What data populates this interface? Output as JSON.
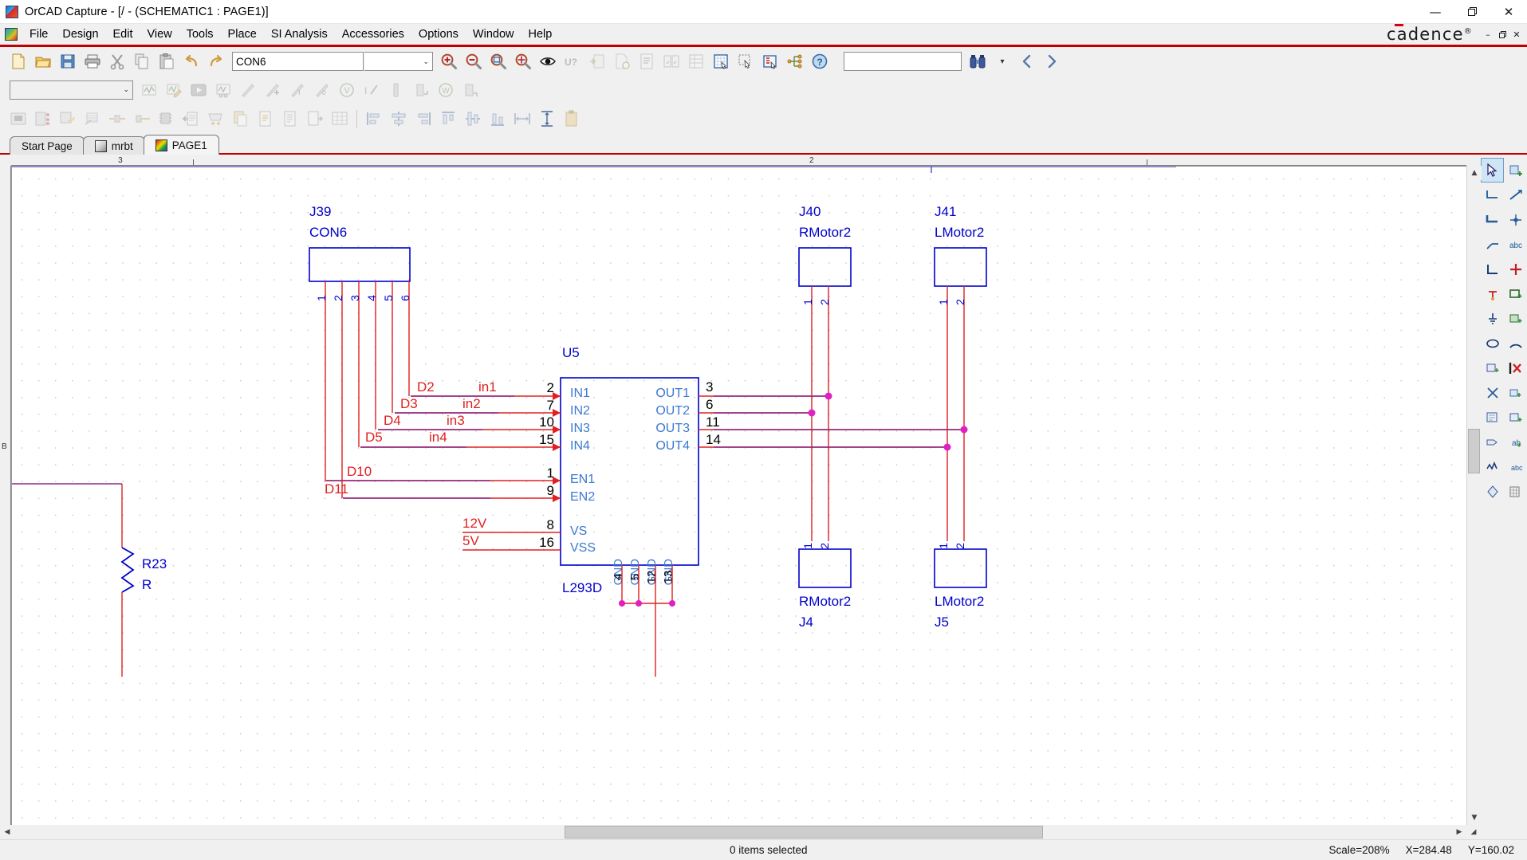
{
  "window": {
    "title": "OrCAD Capture - [/ - (SCHEMATIC1 : PAGE1)]",
    "minimize": "—",
    "maximize": "❐",
    "close": "✕",
    "mdi_minimize": "–",
    "mdi_restore": "❐",
    "mdi_close": "✕",
    "brand": "cadence",
    "brand_sup": "®"
  },
  "menu": {
    "items": [
      {
        "label": "File"
      },
      {
        "label": "Design"
      },
      {
        "label": "Edit"
      },
      {
        "label": "View"
      },
      {
        "label": "Tools"
      },
      {
        "label": "Place"
      },
      {
        "label": "SI Analysis"
      },
      {
        "label": "Accessories"
      },
      {
        "label": "Options"
      },
      {
        "label": "Window"
      },
      {
        "label": "Help"
      }
    ]
  },
  "toolbar1": {
    "part_combo_value": "CON6",
    "part_combo_caret": "⌄",
    "find_combo_value": "",
    "find_caret": "▾",
    "buttons": [
      {
        "name": "new-button",
        "title": "New"
      },
      {
        "name": "open-button",
        "title": "Open"
      },
      {
        "name": "save-button",
        "title": "Save"
      },
      {
        "name": "print-button",
        "title": "Print"
      },
      {
        "name": "cut-button",
        "title": "Cut"
      },
      {
        "name": "copy-button",
        "title": "Copy"
      },
      {
        "name": "paste-button",
        "title": "Paste"
      },
      {
        "name": "undo-button",
        "title": "Undo"
      },
      {
        "name": "redo-button",
        "title": "Redo"
      }
    ],
    "zoom_buttons": [
      {
        "name": "zoom-in-button",
        "title": "Zoom In"
      },
      {
        "name": "zoom-out-button",
        "title": "Zoom Out"
      },
      {
        "name": "zoom-area-button",
        "title": "Zoom Area"
      },
      {
        "name": "zoom-all-button",
        "title": "Zoom All"
      },
      {
        "name": "visibility-button",
        "title": "Visibility"
      }
    ],
    "doc_buttons": [
      {
        "name": "annotate-button",
        "title": "Annotate"
      },
      {
        "name": "backannotate-button",
        "title": "Back Annotate"
      },
      {
        "name": "design-rules-check-button",
        "title": "Design Rules Check"
      },
      {
        "name": "create-netlist-button",
        "title": "Create Netlist"
      },
      {
        "name": "cross-reference-button",
        "title": "Cross Reference Parts"
      },
      {
        "name": "bill-of-materials-button",
        "title": "Bill of Materials"
      },
      {
        "name": "snap-to-grid-button",
        "title": "Snap to Grid"
      },
      {
        "name": "area-select-button",
        "title": "Area Select"
      },
      {
        "name": "project-manager-button",
        "title": "Project Manager"
      },
      {
        "name": "hierarchy-button",
        "title": "Hierarchy"
      },
      {
        "name": "help-button",
        "title": "Help"
      }
    ],
    "nav_buttons": [
      {
        "name": "find-button",
        "title": "Find"
      },
      {
        "name": "find-dropdown-button",
        "title": "Find options"
      },
      {
        "name": "prev-button",
        "title": "Previous"
      },
      {
        "name": "next-button",
        "title": "Next"
      }
    ]
  },
  "toolbar2": {
    "combo_value": "",
    "combo_caret": "⌄",
    "buttons": [
      {
        "name": "pspice-new-simulation-button"
      },
      {
        "name": "pspice-edit-simulation-button"
      },
      {
        "name": "pspice-run-button"
      },
      {
        "name": "pspice-view-results-button"
      },
      {
        "name": "voltage-marker-button"
      },
      {
        "name": "current-marker-button"
      },
      {
        "name": "power-marker-button"
      },
      {
        "name": "db-magnitude-marker-button"
      },
      {
        "name": "voltage-level-marker-button"
      },
      {
        "name": "voltage-differential-marker-button"
      },
      {
        "name": "current-into-pin-marker-button"
      },
      {
        "name": "power-dissipation-marker-button"
      },
      {
        "name": "watt-marker-button"
      },
      {
        "name": "advanced-marker-button"
      }
    ]
  },
  "toolbar3": {
    "buttons": [
      {
        "name": "pcb-editor-button"
      },
      {
        "name": "pcb-footprint-button"
      },
      {
        "name": "pcb-constraint-button"
      },
      {
        "name": "pcb-layer-button"
      },
      {
        "name": "pcb-route-in-button"
      },
      {
        "name": "pcb-route-out-button"
      },
      {
        "name": "pcb-package-button"
      },
      {
        "name": "import-button"
      },
      {
        "name": "export-button"
      },
      {
        "name": "copy-design-button"
      },
      {
        "name": "edit-properties-button"
      },
      {
        "name": "view-report-button"
      },
      {
        "name": "export-report-button"
      },
      {
        "name": "spreadsheet-button"
      },
      {
        "name": "align-left-button"
      },
      {
        "name": "align-center-button"
      },
      {
        "name": "align-right-button"
      },
      {
        "name": "align-top-button"
      },
      {
        "name": "align-middle-button"
      },
      {
        "name": "align-bottom-button"
      },
      {
        "name": "distribute-horizontally-button"
      },
      {
        "name": "distribute-vertically-button"
      },
      {
        "name": "clipboard-button"
      }
    ]
  },
  "tabs": [
    {
      "label": "Start Page",
      "icon": "none",
      "active": false
    },
    {
      "label": "mrbt",
      "icon": "mrbt",
      "active": false
    },
    {
      "label": "PAGE1",
      "icon": "page",
      "active": true
    }
  ],
  "rulers": {
    "h_labels": [
      {
        "text": "3",
        "pos_pct": 7.5
      },
      {
        "text": "2",
        "pos_pct": 55.0
      }
    ],
    "v_labels": [
      {
        "text": "B",
        "pos_pct": 42.0
      }
    ]
  },
  "statusbar": {
    "selection": "0 items selected",
    "scale": "Scale=208%",
    "coord_x": "X=284.48",
    "coord_y": "Y=160.02"
  },
  "right_toolbar": {
    "buttons": [
      {
        "name": "select-tool-button",
        "selected": true
      },
      {
        "name": "place-part-button",
        "selected": false
      },
      {
        "name": "place-wire-button",
        "selected": false
      },
      {
        "name": "place-net-alias-button",
        "selected": false
      },
      {
        "name": "place-bus-button",
        "selected": false
      },
      {
        "name": "place-junction-button",
        "selected": false
      },
      {
        "name": "place-bus-entry-button",
        "selected": false
      },
      {
        "name": "place-text-button",
        "selected": false
      },
      {
        "name": "place-line-button",
        "selected": false
      },
      {
        "name": "place-cross-button",
        "selected": false
      },
      {
        "name": "place-power-button",
        "selected": false
      },
      {
        "name": "place-rectangle-button",
        "selected": false
      },
      {
        "name": "place-ground-button",
        "selected": false
      },
      {
        "name": "place-polyline-button",
        "selected": false
      },
      {
        "name": "place-ellipse-button",
        "selected": false
      },
      {
        "name": "place-arc-button",
        "selected": false
      },
      {
        "name": "place-port-button",
        "selected": false
      },
      {
        "name": "delete-button",
        "selected": false
      },
      {
        "name": "place-no-connect-button",
        "selected": false
      },
      {
        "name": "place-pin-button",
        "selected": false
      },
      {
        "name": "place-hierarchical-block-button",
        "selected": false
      },
      {
        "name": "place-hierarchical-pin-button",
        "selected": false
      },
      {
        "name": "place-off-page-connector-button",
        "selected": false
      },
      {
        "name": "place-alias-button",
        "selected": false
      },
      {
        "name": "zoom-selection-button",
        "selected": false
      },
      {
        "name": "place-picture-button",
        "selected": false
      },
      {
        "name": "place-elec-rule-button",
        "selected": false
      },
      {
        "name": "place-grid-button",
        "selected": false
      }
    ]
  },
  "schematic": {
    "components": [
      {
        "ref": "J39",
        "value": "CON6",
        "type": "connector",
        "pin_numbers": [
          "1",
          "2",
          "3",
          "4",
          "5",
          "6"
        ]
      },
      {
        "ref": "J40",
        "value": "RMotor2",
        "type": "connector",
        "pin_numbers": [
          "1",
          "2"
        ]
      },
      {
        "ref": "J41",
        "value": "LMotor2",
        "type": "connector",
        "pin_numbers": [
          "1",
          "2"
        ]
      },
      {
        "ref": "J4",
        "value": "RMotor2",
        "type": "connector",
        "pin_numbers": [
          "1",
          "2"
        ]
      },
      {
        "ref": "J5",
        "value": "LMotor2",
        "type": "connector",
        "pin_numbers": [
          "1",
          "2"
        ]
      },
      {
        "ref": "U5",
        "value": "L293D",
        "type": "ic",
        "left_pins": [
          {
            "num": "2",
            "name": "IN1"
          },
          {
            "num": "7",
            "name": "IN2"
          },
          {
            "num": "10",
            "name": "IN3"
          },
          {
            "num": "15",
            "name": "IN4"
          },
          {
            "num": "1",
            "name": "EN1"
          },
          {
            "num": "9",
            "name": "EN2"
          },
          {
            "num": "8",
            "name": "VS"
          },
          {
            "num": "16",
            "name": "VSS"
          }
        ],
        "right_pins": [
          {
            "num": "3",
            "name": "OUT1"
          },
          {
            "num": "6",
            "name": "OUT2"
          },
          {
            "num": "11",
            "name": "OUT3"
          },
          {
            "num": "14",
            "name": "OUT4"
          }
        ],
        "bottom_pins": [
          {
            "num": "4",
            "name": "GND"
          },
          {
            "num": "5",
            "name": "GND"
          },
          {
            "num": "12",
            "name": "GND"
          },
          {
            "num": "13",
            "name": "GND"
          }
        ]
      },
      {
        "ref": "R23",
        "value": "R",
        "type": "resistor"
      }
    ],
    "net_labels": [
      {
        "text": "D2"
      },
      {
        "text": "in1"
      },
      {
        "text": "D3"
      },
      {
        "text": "in2"
      },
      {
        "text": "D4"
      },
      {
        "text": "in3"
      },
      {
        "text": "D5"
      },
      {
        "text": "in4"
      },
      {
        "text": "D10"
      },
      {
        "text": "D11"
      },
      {
        "text": "12V"
      },
      {
        "text": "5V"
      }
    ]
  }
}
